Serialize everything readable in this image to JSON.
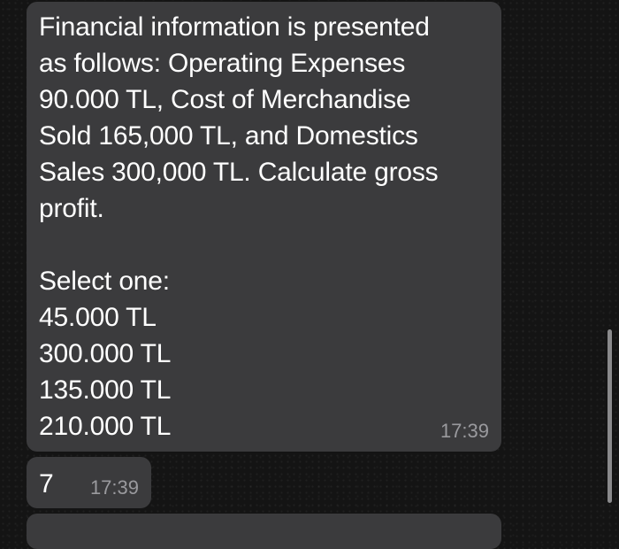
{
  "messages": [
    {
      "text": "Financial information is presented as follows: Operating Expenses 90.000 TL, Cost of Merchandise Sold 165,000 TL, and Domestics Sales 300,000 TL. Calculate gross profit.",
      "options_heading": "Select one:",
      "options": [
        "45.000 TL",
        "300.000 TL",
        "135.000 TL",
        "210.000 TL"
      ],
      "time": "17:39"
    },
    {
      "text": "7",
      "time": "17:39"
    }
  ]
}
